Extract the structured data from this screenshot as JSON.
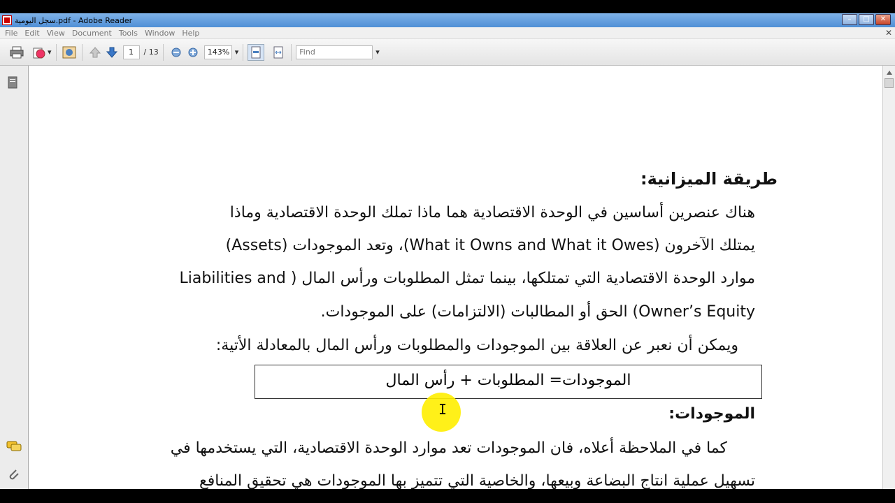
{
  "window": {
    "title": "سجل اليومية.pdf - Adobe Reader",
    "minimize": "0",
    "maximize": "1",
    "close": "r"
  },
  "menu": {
    "items": [
      "File",
      "Edit",
      "View",
      "Document",
      "Tools",
      "Window",
      "Help"
    ],
    "close": "x"
  },
  "toolbar": {
    "page_current": "1",
    "page_total": "/ 13",
    "zoom": "143%",
    "find_placeholder": "Find"
  },
  "document": {
    "heading": "طريقة الميزانية:",
    "lines": [
      "هناك عنصرين أساسين في الوحدة الاقتصادية هما ماذا تملك الوحدة الاقتصادية وماذا",
      "يمتلك الآخرون (What it Owns and What it Owes)، وتعد الموجودات (Assets)",
      "موارد الوحدة الاقتصادية التي تمتلكها، بينما تمثل المطلوبات ورأس المال ( Liabilities and",
      "Owner’s Equity) الحق أو المطالبات (الالتزامات) على الموجودات.",
      "ويمكن أن نعبر عن العلاقة بين الموجودات والمطلوبات ورأس المال بالمعادلة الأتية:"
    ],
    "equation": "الموجودات= المطلوبات + رأس المال",
    "subheading": "الموجودات:",
    "para2_lines": [
      "كما في الملاحظة أعلاه، فان الموجودات تعد موارد الوحدة الاقتصادية، التي يستخدمها في",
      "تسهيل عملية انتاج البضاعة وبيعها، والخاصية التي تتميز بها الموجودات هي تحقيق المنافع"
    ]
  },
  "colors": {
    "titlebar": "#4f8fd6",
    "highlight": "#ffee00"
  }
}
